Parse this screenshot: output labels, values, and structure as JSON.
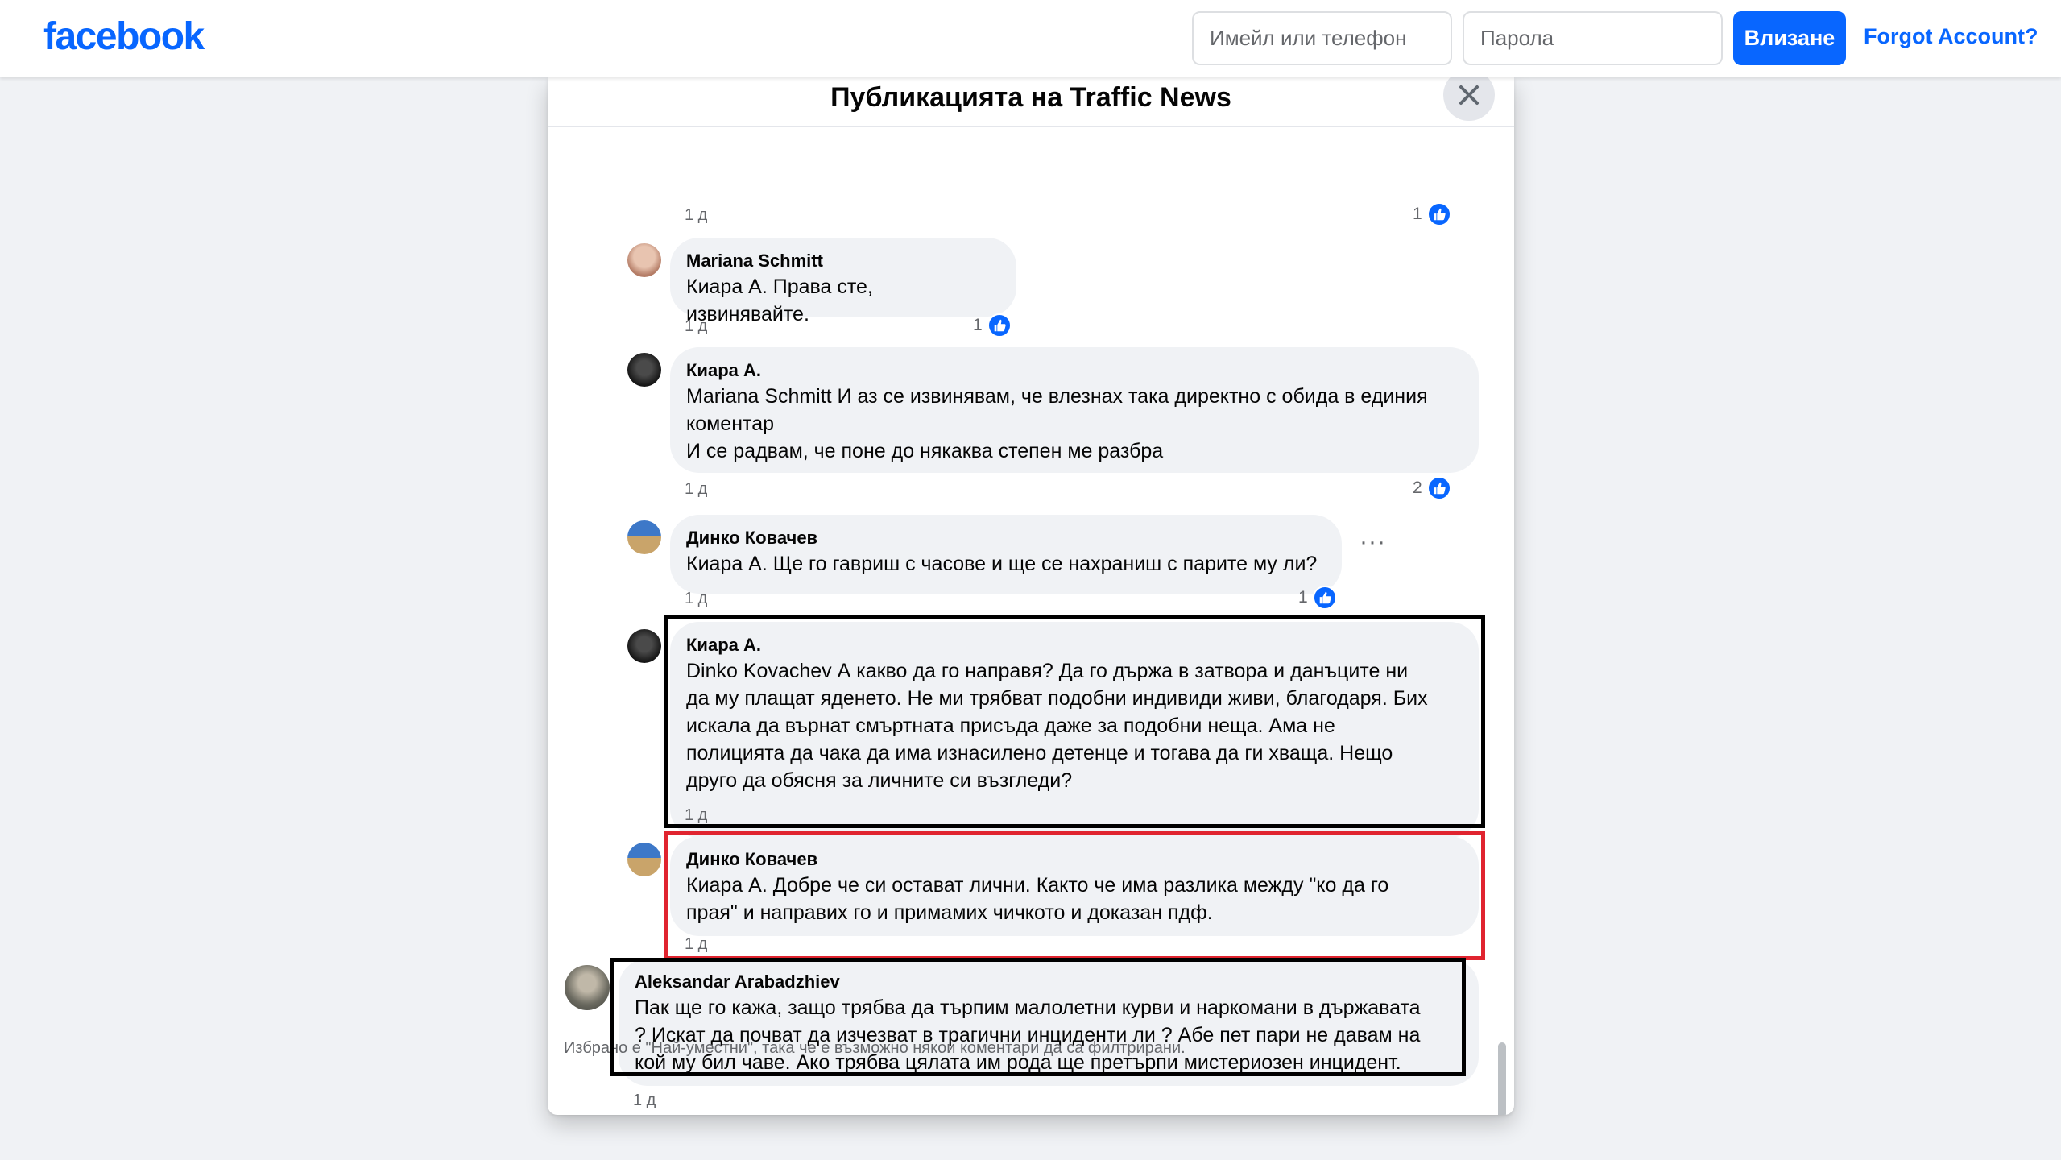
{
  "topbar": {
    "logo": "facebook",
    "email_placeholder": "Имейл или телефон",
    "password_placeholder": "Парола",
    "login_label": "Влизане",
    "forgot_label": "Forgot Account?"
  },
  "dialog": {
    "title": "Публикацията на Traffic News",
    "footer_note": "Избрано е \"Най-уместни\", така че е възможно някои коментари да са филтрирани."
  },
  "top_partial": {
    "time": "1 д",
    "likes": "1"
  },
  "comments": [
    {
      "author": "Mariana Schmitt",
      "text": "Киара А. Права сте, извинявайте.",
      "time": "1 д",
      "likes": "1"
    },
    {
      "author": "Киара А.",
      "text": "Mariana Schmitt И аз се извинявам, че влезнах така директно с обида в единия\nкоментар\nИ се радвам, че поне до някаква степен ме разбра",
      "time": "1 д",
      "likes": "2"
    },
    {
      "author": "Динко Ковачев",
      "text": "Киара А. Ще го гавриш с часове и ще се нахраниш с парите му ли?",
      "time": "1 д",
      "likes": "1",
      "more": "···"
    },
    {
      "author": "Киара А.",
      "text": "Dinko Kovachev А какво да го направя? Да го държа в затвора и данъците ни\nда му плащат яденето. Не ми трябват подобни индивиди живи, благодаря. Бих\nискала да върнат смъртната присъда даже за подобни неща. Ама не\nполицията да чака да има изнасилено детенце и тогава да ги хваща. Нещо\nдруго да обясня за личните си възгледи?",
      "time": "1 д"
    },
    {
      "author": "Динко Ковачев",
      "text": "Киара А. Добре че си остават лични. Както че има разлика между \"ко да го\nпрая\" и направих го и примамих чичкото и доказан пдф.",
      "time": "1 д"
    },
    {
      "author": "Aleksandar Arabadzhiev",
      "text": "Пак ще го кажа, защо трябва да търпим малолетни курви и наркомани в държавата\n? Искат да почват да изчезват в трагични инциденти ли ? Абе пет пари не давам на\nкой му бил чаве. Ако трябва цялата им рода ще претърпи мистериозен инцидент.",
      "time": "1 д"
    }
  ],
  "colors": {
    "brand": "#0866ff",
    "bubble": "#f0f2f5",
    "highlight_black": "#000000",
    "highlight_red": "#e0242f"
  }
}
